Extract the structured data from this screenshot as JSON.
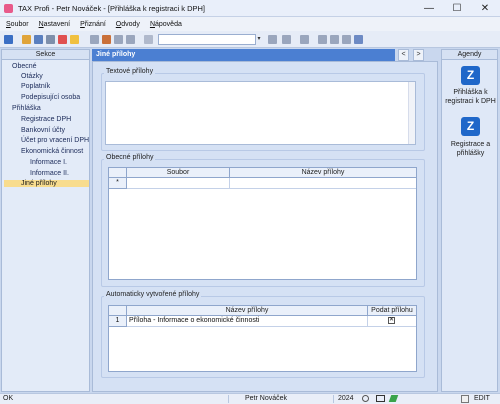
{
  "window": {
    "title": "TAX Profi - Petr Nováček - [Přihláška k registraci k DPH]",
    "minimize_glyph": "—",
    "maximize_glyph": "☐",
    "close_glyph": "✕"
  },
  "menu": {
    "items": [
      {
        "label": "Soubor"
      },
      {
        "label": "Nastavení"
      },
      {
        "label": "Přiznání"
      },
      {
        "label": "Odvody"
      },
      {
        "label": "Nápověda"
      }
    ]
  },
  "toolbar": {
    "combo_value": "",
    "combo_arrow": "▾"
  },
  "sidebar": {
    "header": "Sekce",
    "items": [
      {
        "label": "Obecné",
        "level": 0
      },
      {
        "label": "Otázky",
        "level": 1
      },
      {
        "label": "Poplatník",
        "level": 1
      },
      {
        "label": "Podepisující osoba",
        "level": 1
      },
      {
        "label": "Přihláška",
        "level": 0
      },
      {
        "label": "Registrace DPH",
        "level": 1
      },
      {
        "label": "Bankovní účty",
        "level": 1
      },
      {
        "label": "Účet pro vracení DPH",
        "level": 1
      },
      {
        "label": "Ekonomická činnost",
        "level": 1
      },
      {
        "label": "Informace I.",
        "level": 2
      },
      {
        "label": "Informace II.",
        "level": 2
      },
      {
        "label": "Jiné přílohy",
        "level": 1,
        "selected": true
      }
    ]
  },
  "main": {
    "title": "Jiné přílohy",
    "nav_prev": "<",
    "nav_next": ">",
    "textove_prilohy": {
      "label": "Textové přílohy",
      "value": ""
    },
    "obecne_prilohy": {
      "label": "Obecné přílohy",
      "columns": [
        "Soubor",
        "Název přílohy"
      ],
      "new_row_marker": "*"
    },
    "automaticke_prilohy": {
      "label": "Automaticky vytvořené přílohy",
      "columns": [
        "Název přílohy",
        "Podat přílohu"
      ],
      "rows": [
        {
          "num": "1",
          "name": "Příloha - Informace o ekonomické činnosti",
          "checked": "✕"
        }
      ]
    }
  },
  "agendy": {
    "header": "Agendy",
    "items": [
      {
        "label": "Přihláška k registraci k DPH",
        "icon_letter": "Z"
      },
      {
        "label": "Registrace a přihlášky",
        "icon_letter": "Z"
      }
    ]
  },
  "status": {
    "left": "OK",
    "user": "Petr Nováček",
    "year": "2024",
    "mode": "EDIT"
  }
}
